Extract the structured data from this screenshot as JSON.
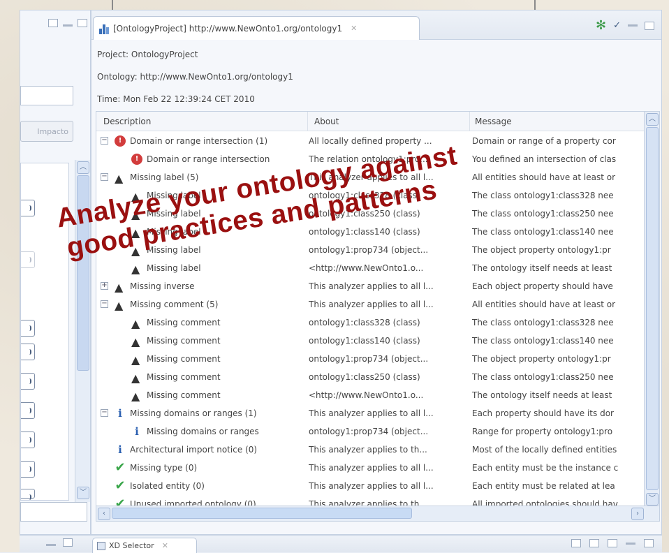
{
  "left_panel": {
    "button_label": "Impacto"
  },
  "editor_tab": {
    "title": "[OntologyProject] http://www.NewOnto1.org/ontology1",
    "close_glyph": "✕"
  },
  "info": {
    "project": "Project: OntologyProject",
    "ontology": "Ontology: http://www.NewOnto1.org/ontology1",
    "time": "Time: Mon Feb 22 12:39:24 CET 2010"
  },
  "table": {
    "columns": [
      "Description",
      "About",
      "Message"
    ],
    "rows": [
      {
        "level": 0,
        "expander": "−",
        "icon": "error",
        "desc": "Domain or range intersection (1)",
        "about": "All locally defined property ...",
        "message": "Domain or range of a property cor"
      },
      {
        "level": 1,
        "expander": "",
        "icon": "error",
        "desc": "Domain or range intersection",
        "about": "The relation ontology1:pro...",
        "message": "You defined an intersection of clas"
      },
      {
        "level": 0,
        "expander": "−",
        "icon": "warning",
        "desc": "Missing label (5)",
        "about": "This analyzer applies to all l...",
        "message": "All entities should have at least or"
      },
      {
        "level": 1,
        "expander": "",
        "icon": "warning",
        "desc": "Missing label",
        "about": "ontology1:class328 (class)",
        "message": "The class ontology1:class328 nee"
      },
      {
        "level": 1,
        "expander": "",
        "icon": "warning",
        "desc": "Missing label",
        "about": "ontology1:class250 (class)",
        "message": "The class ontology1:class250 nee"
      },
      {
        "level": 1,
        "expander": "",
        "icon": "warning",
        "desc": "Missing label",
        "about": "ontology1:class140 (class)",
        "message": "The class ontology1:class140 nee"
      },
      {
        "level": 1,
        "expander": "",
        "icon": "warning",
        "desc": "Missing label",
        "about": "ontology1:prop734 (object...",
        "message": "The object property ontology1:pr"
      },
      {
        "level": 1,
        "expander": "",
        "icon": "warning",
        "desc": "Missing label",
        "about": "<http://www.NewOnto1.o...",
        "message": "The ontology itself needs at least"
      },
      {
        "level": 0,
        "expander": "+",
        "icon": "warning",
        "desc": "Missing inverse",
        "about": "This analyzer applies to all l...",
        "message": "Each object property should have"
      },
      {
        "level": 0,
        "expander": "−",
        "icon": "warning",
        "desc": "Missing comment (5)",
        "about": "This analyzer applies to all l...",
        "message": "All entities should have at least or"
      },
      {
        "level": 1,
        "expander": "",
        "icon": "warning",
        "desc": "Missing comment",
        "about": "ontology1:class328 (class)",
        "message": "The class ontology1:class328 nee"
      },
      {
        "level": 1,
        "expander": "",
        "icon": "warning",
        "desc": "Missing comment",
        "about": "ontology1:class140 (class)",
        "message": "The class ontology1:class140 nee"
      },
      {
        "level": 1,
        "expander": "",
        "icon": "warning",
        "desc": "Missing comment",
        "about": "ontology1:prop734 (object...",
        "message": "The object property ontology1:pr"
      },
      {
        "level": 1,
        "expander": "",
        "icon": "warning",
        "desc": "Missing comment",
        "about": "ontology1:class250 (class)",
        "message": "The class ontology1:class250 nee"
      },
      {
        "level": 1,
        "expander": "",
        "icon": "warning",
        "desc": "Missing comment",
        "about": "<http://www.NewOnto1.o...",
        "message": "The ontology itself needs at least"
      },
      {
        "level": 0,
        "expander": "−",
        "icon": "info",
        "desc": "Missing domains or ranges (1)",
        "about": "This analyzer applies to all l...",
        "message": "Each property should have its dor"
      },
      {
        "level": 1,
        "expander": "",
        "icon": "info",
        "desc": "Missing domains or ranges",
        "about": "ontology1:prop734 (object...",
        "message": "Range for property ontology1:pro"
      },
      {
        "level": 0,
        "expander": "",
        "icon": "info",
        "desc": "Architectural import notice (0)",
        "about": "This analyzer applies to th...",
        "message": "Most of the locally defined entities"
      },
      {
        "level": 0,
        "expander": "",
        "icon": "ok",
        "desc": "Missing type (0)",
        "about": "This analyzer applies to all l...",
        "message": "Each entity must be the instance c"
      },
      {
        "level": 0,
        "expander": "",
        "icon": "ok",
        "desc": "Isolated entity (0)",
        "about": "This analyzer applies to all l...",
        "message": "Each entity must be related at lea"
      },
      {
        "level": 0,
        "expander": "",
        "icon": "ok",
        "desc": "Unused imported ontology (0)",
        "about": "This analyzer applies to th...",
        "message": "All imported ontologies should hav"
      }
    ]
  },
  "bottom_tab": {
    "title": "XD Selector",
    "close_glyph": "✕"
  },
  "overlay": {
    "line1": "Analyze your ontology against",
    "line2": "good practices and patterns"
  },
  "icons": {
    "error": "error-icon",
    "warning": "warning-icon",
    "info": "info-icon",
    "ok": "check-icon"
  }
}
